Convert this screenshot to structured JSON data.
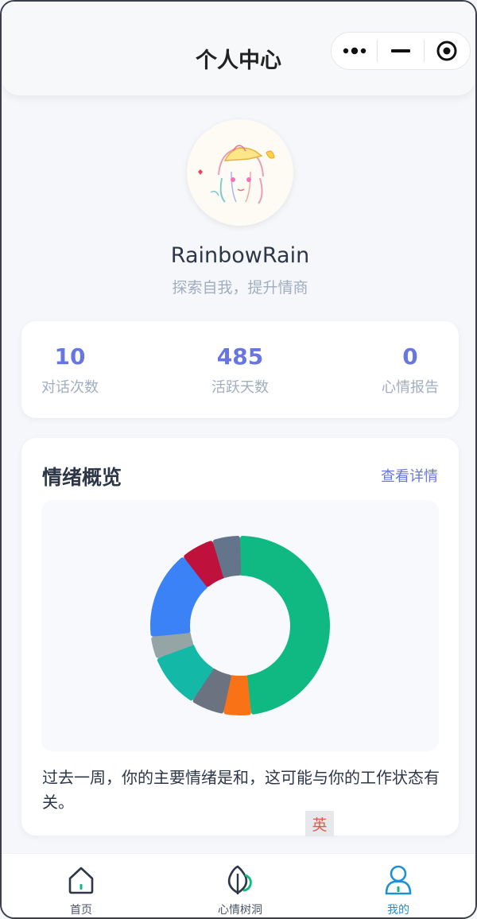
{
  "header": {
    "title": "个人中心"
  },
  "profile": {
    "username": "RainbowRain",
    "motto": "探索自我，提升情商"
  },
  "stats": [
    {
      "value": "10",
      "label": "对话次数"
    },
    {
      "value": "485",
      "label": "活跃天数"
    },
    {
      "value": "0",
      "label": "心情报告"
    }
  ],
  "mood": {
    "title": "情绪概览",
    "detail_link": "查看详情",
    "summary": "过去一周，你的主要情绪是和，这可能与你的工作状态有关。"
  },
  "chart_data": {
    "type": "pie",
    "style": "donut",
    "slices": [
      {
        "value": 48,
        "color": "#10b981"
      },
      {
        "value": 5,
        "color": "#f97316"
      },
      {
        "value": 6,
        "color": "#6b7280"
      },
      {
        "value": 10,
        "color": "#14b8a6"
      },
      {
        "value": 4,
        "color": "#95a5a6"
      },
      {
        "value": 16,
        "color": "#3b82f6"
      },
      {
        "value": 6,
        "color": "#be123c"
      },
      {
        "value": 5,
        "color": "#64748b"
      }
    ]
  },
  "ime": {
    "label": "英"
  },
  "tabbar": {
    "items": [
      {
        "label": "首页",
        "icon": "home-icon"
      },
      {
        "label": "心情树洞",
        "icon": "leaf-icon"
      },
      {
        "label": "我的",
        "icon": "user-icon"
      }
    ],
    "active_color": "#1e90d6"
  }
}
